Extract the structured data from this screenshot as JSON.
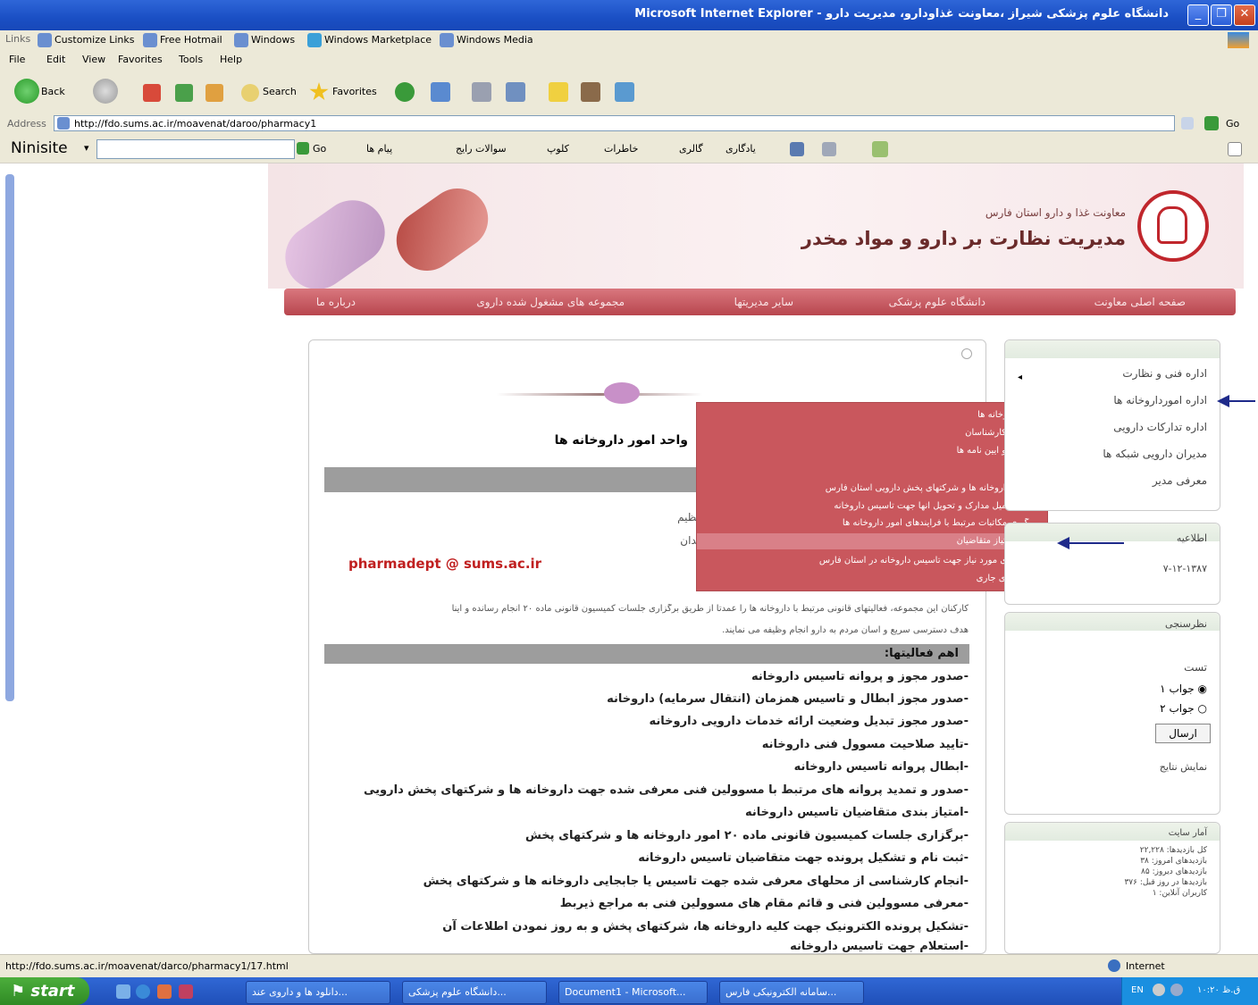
{
  "window": {
    "title": "دانشگاه علوم پزشکی شیراز ،معاونت غذاودارو، مدیریت دارو - Microsoft Internet Explorer",
    "colors": {
      "titlebar": "#1a4fc4",
      "accent": "#c9575d"
    }
  },
  "links_bar": {
    "label": "Links",
    "items": [
      "Customize Links",
      "Free Hotmail",
      "Windows",
      "Windows Marketplace",
      "Windows Media"
    ]
  },
  "menu": [
    "File",
    "Edit",
    "View",
    "Favorites",
    "Tools",
    "Help"
  ],
  "toolbar": {
    "back": "Back",
    "search": "Search",
    "favorites": "Favorites"
  },
  "address": {
    "label": "Address",
    "url": "http://fdo.sums.ac.ir/moavenat/daroo/pharmacy1",
    "go": "Go"
  },
  "nini_bar": {
    "brand": "Ninisite",
    "go": "Go",
    "items": [
      "پیام ها",
      "سوالات رایج",
      "کلوپ",
      "خاطرات",
      "گالری",
      "یادگاری"
    ]
  },
  "header": {
    "subtitle": "معاونت غذا و دارو استان فارس",
    "title": "مدیریت نظارت بر دارو و مواد مخدر"
  },
  "nav": [
    "صفحه اصلی معاونت",
    "دانشگاه علوم پزشکی",
    "سایر مدیریتها",
    "مجموعه های مشغول شده داروی",
    "درباره ما"
  ],
  "main": {
    "headline": "واحد امور داروخانه ها",
    "paragraph": [
      "دارو و مواد مخدر معاونت غذاودارو دانشگاه بوده و در طیفه تنظیم",
      "درمانی استان فارس به نشانی شیراز خیابان زند ترسیده به میدان",
      "pharmadept @ sums.ac.ir"
    ],
    "goal_line_1": "کارکنان این مجموعه، فعالیتهای قانونی مرتبط با داروخانه ها را عمدتا از طریق برگزاری جلسات کمیسیون قانونی ماده ۲۰ انجام رسانده و اینا",
    "goal_line_2": "هدف دسترسی سریع و آسان مردم به دارو انجام وظیفه می نمایند.",
    "activities_title": "اهم فعالیتها:",
    "activities": [
      "-صدور مجوز و پروانه تاسیس داروخانه",
      "-صدور مجوز ابطال و تاسیس همزمان (انتقال سرمایه) داروخانه",
      "-صدور مجوز تبدیل وضعیت ارائه خدمات دارویی داروخانه",
      "-تایید صلاحیت مسوول فنی داروخانه",
      "-ابطال پروانه تاسیس داروخانه",
      "-صدور و تمدید پروانه های مرتبط با مسوولین فنی معرفی شده جهت داروخانه ها و شرکتهای پخش دارویی",
      "-امتیاز بندی متقاضیان تاسیس داروخانه",
      "-برگزاری جلسات کمیسیون قانونی ماده ۲۰ امور داروخانه ها و شرکتهای پخش",
      "-ثبت نام و تشکیل پرونده جهت متقاضیان تاسیس داروخانه",
      "-انجام کارشناسی از محلهای معرفی شده جهت تاسیس یا جابجایی داروخانه ها و شرکتهای پخش",
      "-معرفی مسوولین فنی و قائم مقام های مسوولین فنی به مراجع ذیربط",
      "-تشکیل پرونده الکترونیک جهت کلیه داروخانه ها، شرکتهای پخش و به روز نمودن اطلاعات آن",
      "-استعلام جهت تاسیس داروخانه"
    ]
  },
  "popup_menu": {
    "items": [
      "امورداروخانه ها",
      "معرفی کارشناسان",
      "ضوابط و آیین نامه ها",
      "فرم ها",
      "لیست داروخانه ها و شرکتهای پخش دارویی استان فارس",
      "نحوه تکمیل مدارک و تحویل آنها جهت تاسیس داروخانه",
      "پیگیری مکاتبات مرتبط با فرآیندهای امور داروخانه ها",
      "نتیجه امتیاز متقاضیان",
      "محل های مورد نیاز جهت تاسیس داروخانه در استان فارس",
      "فرآیندهای جاری"
    ],
    "highlighted_index": 7
  },
  "sidebar": {
    "menu": [
      "اداره فنی و نظارت",
      "اداره امورداروخانه ها",
      "اداره تدارکات دارویی",
      "مدیران دارویی شبکه ها",
      "معرفی مدیر"
    ],
    "news_title": "اطلاعیه",
    "news_date": "۷-۱۲-۱۳۸۷",
    "poll_title": "نظرسنجی",
    "poll_question": "تست",
    "poll_options": [
      "جواب ۱",
      "جواب ۲"
    ],
    "poll_selected": 0,
    "poll_submit": "ارسال",
    "poll_results": "نمایش نتایج",
    "stats_title": "آمار سایت",
    "stats_lines": [
      "کل بازدیدها: ۲۲,۲۲۸",
      "بازدیدهای امروز: ۳۸",
      "بازدیدهای دیروز: ۸۵",
      "بازدیدها در روز قبل: ۳۷۶",
      "کاربران آنلاین: ۱"
    ]
  },
  "statusbar": {
    "url": "http://fdo.sums.ac.ir/moavenat/darco/pharmacy1/17.html",
    "zone": "Internet"
  },
  "taskbar": {
    "start": "start",
    "tasks": [
      "دانلود ها و داروی عند...",
      "دانشگاه علوم پزشکی...",
      "Document1 - Microsoft...",
      "سامانه الکترونیکی فارس..."
    ],
    "lang": "EN",
    "clock": "۱۰:۲۰ ق.ظ"
  }
}
